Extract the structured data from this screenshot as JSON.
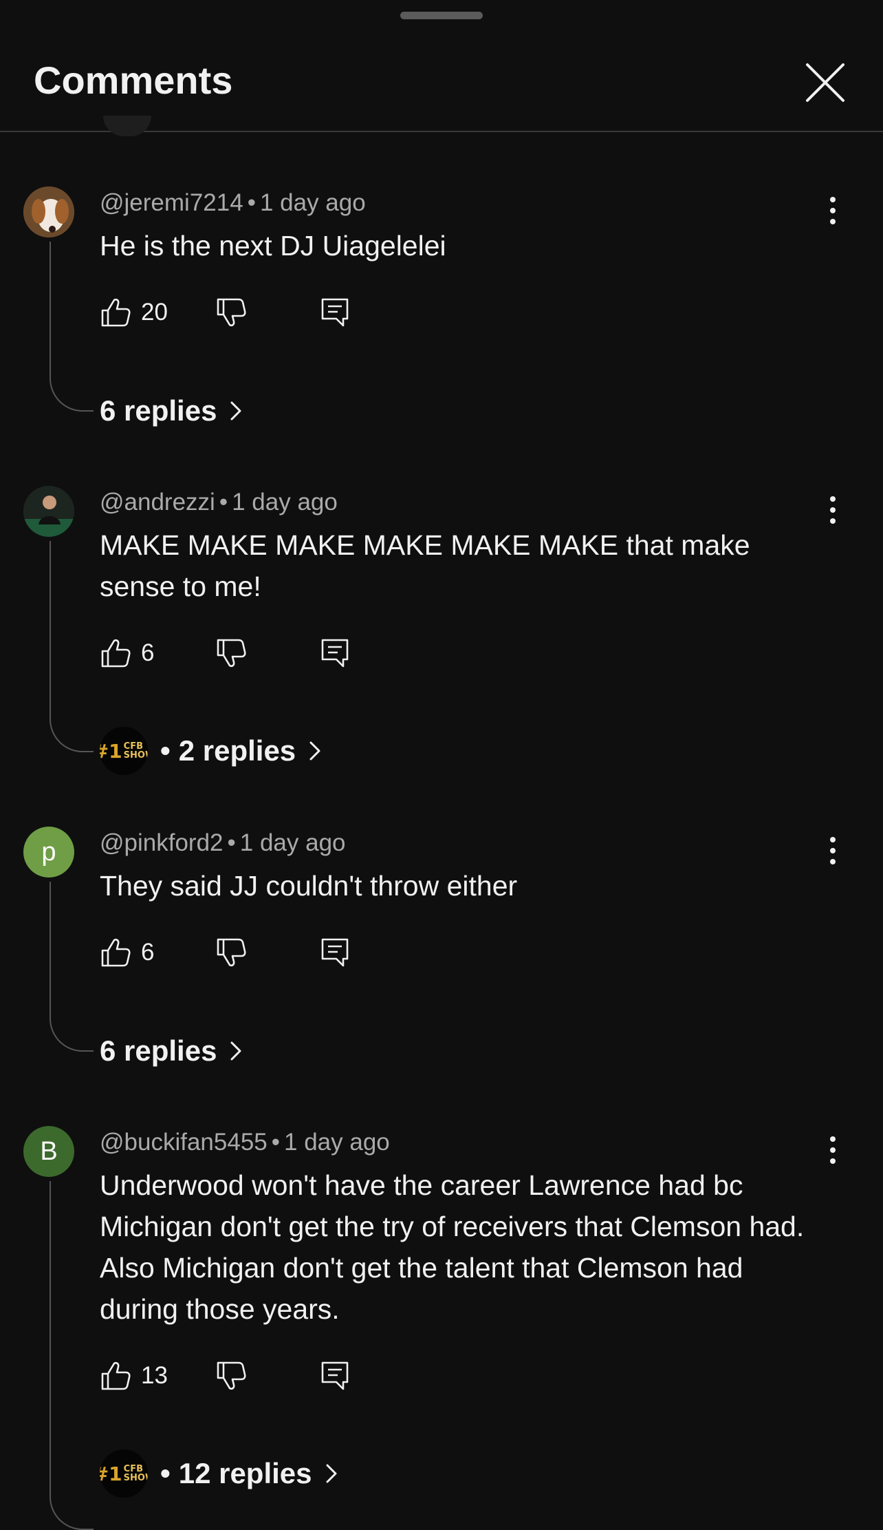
{
  "sheet": {
    "title": "Comments",
    "close_icon": "close-icon"
  },
  "comments": [
    {
      "handle": "@jeremi7214",
      "time": "1 day ago",
      "text": "He is the next DJ Uiagelelei",
      "likes": "20",
      "replies": "6 replies",
      "avatar_type": "photo-dog",
      "avatar_letter": "",
      "avatar_color": "#8a5a2b"
    },
    {
      "handle": "@andrezzi",
      "time": "1 day ago",
      "text": "MAKE MAKE MAKE MAKE MAKE MAKE that make sense to me!",
      "likes": "6",
      "replies": "2 replies",
      "creator_reply": true,
      "avatar_type": "photo-person",
      "avatar_letter": "",
      "avatar_color": "#2a3a2e"
    },
    {
      "handle": "@pinkford2",
      "time": "1 day ago",
      "text": "They said JJ couldn't throw either",
      "likes": "6",
      "replies": "6 replies",
      "avatar_type": "letter",
      "avatar_letter": "p",
      "avatar_color": "#6f9e46"
    },
    {
      "handle": "@buckifan5455",
      "time": "1 day ago",
      "text": "Underwood won't have the career Lawrence had bc Michigan don't get the try of receivers that Clemson had. Also Michigan don't get the talent that Clemson had during those years.",
      "likes": "13",
      "replies": "12 replies",
      "creator_reply": true,
      "avatar_type": "letter",
      "avatar_letter": "B",
      "avatar_color": "#3c6a2d"
    }
  ],
  "creator_avatar": {
    "rank": "#1",
    "name_line1": "CFB",
    "name_line2": "SHOW"
  },
  "separator": "•",
  "colors": {
    "background": "#0f0f0f",
    "text": "#f1f1f1",
    "secondary": "#aaaaaa"
  }
}
